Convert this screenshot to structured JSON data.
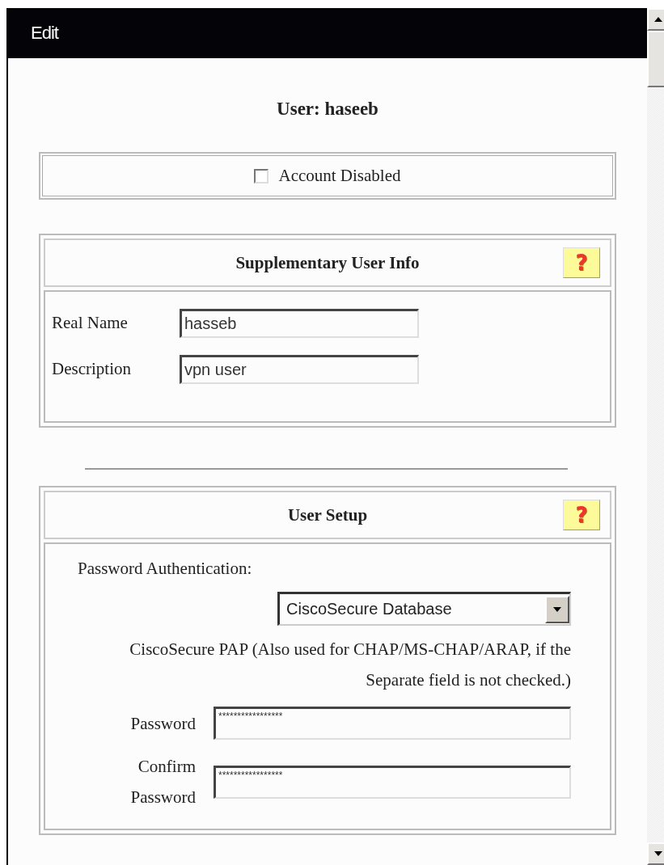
{
  "window": {
    "title": "Edit"
  },
  "heading": "User: haseeb",
  "account_disabled": {
    "label": "Account Disabled",
    "checked": false
  },
  "supplementary": {
    "title": "Supplementary User Info",
    "help": "?",
    "fields": [
      {
        "label": "Real Name",
        "value": "hasseb"
      },
      {
        "label": "Description",
        "value": "vpn user"
      }
    ]
  },
  "user_setup": {
    "title": "User Setup",
    "help": "?",
    "auth_label": "Password Authentication:",
    "auth_select": {
      "value": "CiscoSecure Database"
    },
    "note": "CiscoSecure PAP (Also used for CHAP/MS-CHAP/ARAP, if the Separate field is not checked.)",
    "fields": [
      {
        "label": "Password",
        "value": "*****************"
      },
      {
        "label": "Confirm Password",
        "value": "*****************"
      }
    ]
  }
}
